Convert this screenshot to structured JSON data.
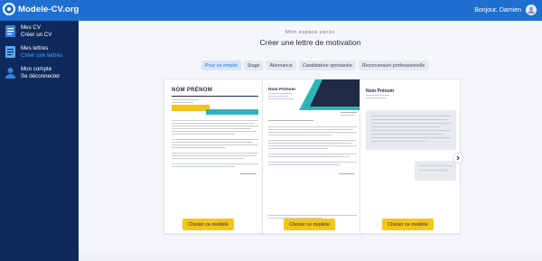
{
  "header": {
    "logo_text": "Modele-CV.org",
    "greeting": "Bonjour, Damien"
  },
  "sidebar": {
    "groups": [
      {
        "title": "Mes CV",
        "links": [
          {
            "label": "Créer un CV",
            "active": false
          }
        ]
      },
      {
        "title": "Mes lettres",
        "links": [
          {
            "label": "Créer une lettres",
            "active": true
          }
        ]
      },
      {
        "title": "Mon compte",
        "links": [
          {
            "label": "Se déconnecter",
            "active": false
          }
        ]
      }
    ]
  },
  "main": {
    "eyebrow": "Mon espace perso",
    "title": "Créer une lettre de motivation",
    "tabs": [
      {
        "label": "Pour un emploi",
        "active": true
      },
      {
        "label": "Stage",
        "active": false
      },
      {
        "label": "Alternance",
        "active": false
      },
      {
        "label": "Candidature spontanée",
        "active": false
      },
      {
        "label": "Reconversion professionnelle",
        "active": false
      }
    ],
    "cards": [
      {
        "heading": "NOM PRÉNOM",
        "button": "Choisir ce modèle"
      },
      {
        "heading": "Nom Prénom",
        "button": "Choisir ce modèle"
      },
      {
        "heading": "Nom Prénom",
        "button": "Choisir ce modèle"
      }
    ]
  },
  "colors": {
    "topbar": "#1f6fd0",
    "sidebar": "#0e2a5c",
    "accent_yellow": "#f5c518",
    "accent_teal": "#2bb5b8",
    "active_link": "#4aa3ff"
  },
  "icons": {
    "logo": "circle-logo-icon",
    "avatar": "user-avatar-icon",
    "cv": "document-icon",
    "letters": "letter-icon",
    "account": "user-icon",
    "next": "chevron-right-icon"
  }
}
